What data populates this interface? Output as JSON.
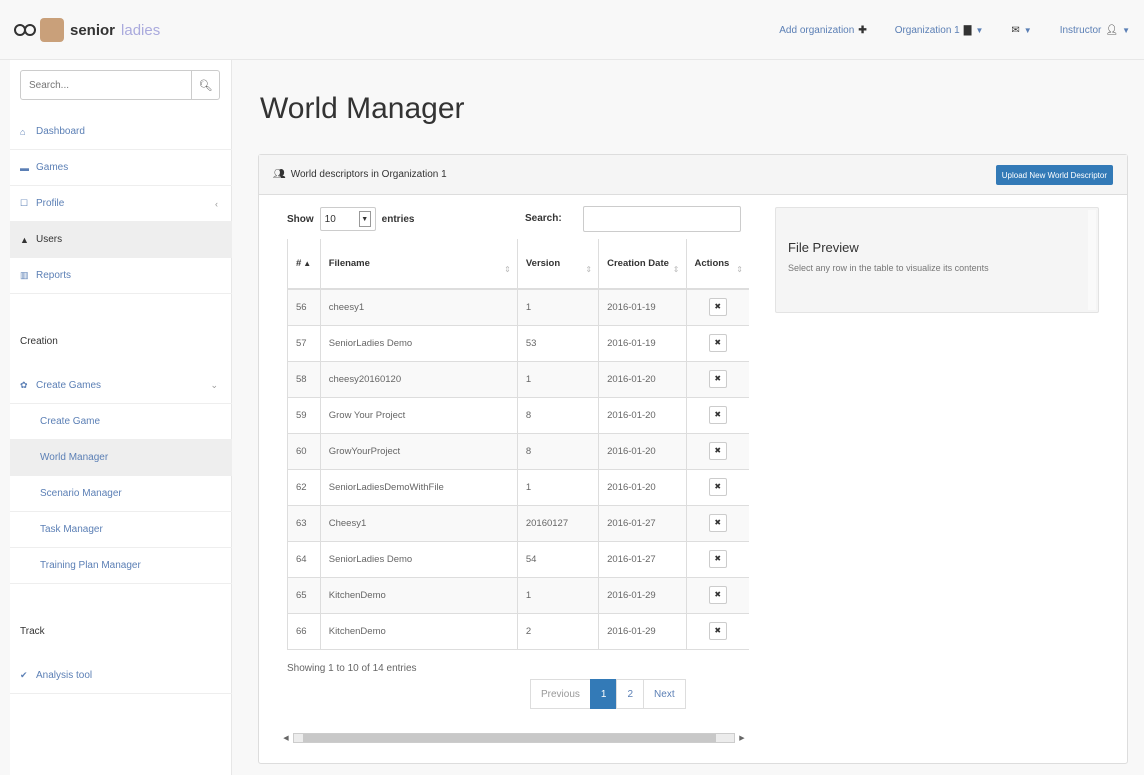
{
  "brand": {
    "name": "senior",
    "name2": "ladies"
  },
  "navbar": {
    "add_org": "Add organization",
    "organization": "Organization 1",
    "user": "Instructor"
  },
  "sidebar": {
    "search_placeholder": "Search...",
    "items": [
      {
        "label": "Dashboard",
        "icon": "dashboard-icon"
      },
      {
        "label": "Games",
        "icon": "gamepad-icon"
      },
      {
        "label": "Profile",
        "icon": "profile-icon"
      },
      {
        "label": "Users",
        "icon": "user-icon"
      },
      {
        "label": "Reports",
        "icon": "chart-icon"
      }
    ],
    "creation_heading": "Creation",
    "create_games": "Create Games",
    "sub_items": [
      "Create Game",
      "World Manager",
      "Scenario Manager",
      "Task Manager",
      "Training Plan Manager"
    ],
    "track_heading": "Track",
    "analysis": "Analysis tool"
  },
  "main": {
    "title": "World Manager",
    "panel_heading": "World descriptors in Organization 1",
    "upload_button": "Upload New World Descriptor",
    "show": "Show",
    "entries": "entries",
    "length_value": "10",
    "search_label": "Search:",
    "columns": [
      "#",
      "Filename",
      "Version",
      "Creation Date",
      "Actions"
    ],
    "rows": [
      {
        "id": "56",
        "filename": "cheesy1",
        "version": "1",
        "date": "2016-01-19"
      },
      {
        "id": "57",
        "filename": "SeniorLadies Demo",
        "version": "53",
        "date": "2016-01-19"
      },
      {
        "id": "58",
        "filename": "cheesy20160120",
        "version": "1",
        "date": "2016-01-20"
      },
      {
        "id": "59",
        "filename": "Grow Your Project",
        "version": "8",
        "date": "2016-01-20"
      },
      {
        "id": "60",
        "filename": "GrowYourProject",
        "version": "8",
        "date": "2016-01-20"
      },
      {
        "id": "62",
        "filename": "SeniorLadiesDemoWithFile",
        "version": "1",
        "date": "2016-01-20"
      },
      {
        "id": "63",
        "filename": "Cheesy1",
        "version": "20160127",
        "date": "2016-01-27"
      },
      {
        "id": "64",
        "filename": "SeniorLadies Demo",
        "version": "54",
        "date": "2016-01-27"
      },
      {
        "id": "65",
        "filename": "KitchenDemo",
        "version": "1",
        "date": "2016-01-29"
      },
      {
        "id": "66",
        "filename": "KitchenDemo",
        "version": "2",
        "date": "2016-01-29"
      }
    ],
    "info": "Showing 1 to 10 of 14 entries",
    "pagination": {
      "previous": "Previous",
      "pages": [
        "1",
        "2"
      ],
      "next": "Next"
    },
    "preview": {
      "title": "File Preview",
      "text": "Select any row in the table to visualize its contents"
    }
  }
}
